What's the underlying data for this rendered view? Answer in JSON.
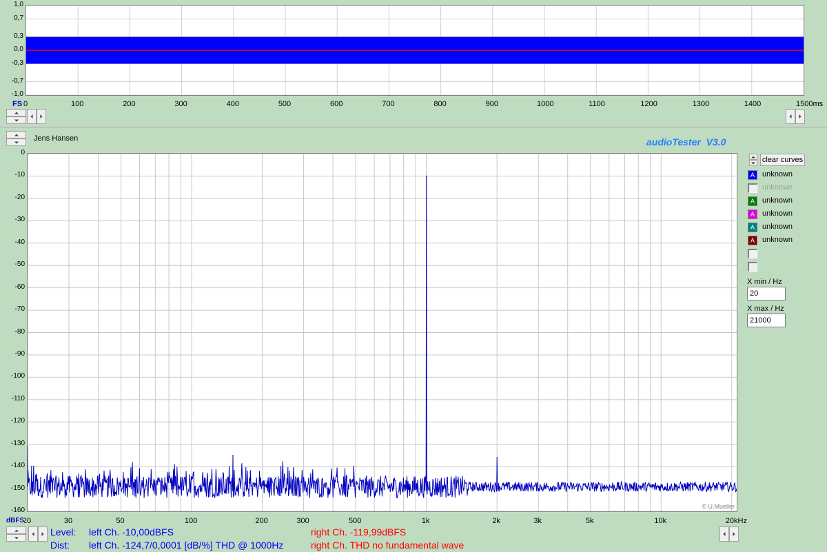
{
  "top_plot": {
    "y_ticks": [
      "1,0",
      "0,7",
      "0,3",
      "0,0",
      "-0,3",
      "-0,7",
      "-1,0"
    ],
    "x_ticks": [
      "0",
      "100",
      "200",
      "300",
      "400",
      "500",
      "600",
      "700",
      "800",
      "900",
      "1000",
      "1100",
      "1200",
      "1300",
      "1400",
      "1500ms"
    ],
    "y_unit": "FS",
    "fill_color": "#0000ff",
    "line_color": "#ff0000",
    "signal_level_range": [
      -0.3,
      0.3
    ]
  },
  "header": {
    "user_name": "Jens Hansen",
    "app_title": "audioTester  V3.0"
  },
  "spectrum": {
    "y_unit": "dBFS",
    "x_unit": "Hz",
    "credit": "© U.Mueller",
    "line_color": "#0000c0"
  },
  "chart_data": {
    "type": "line",
    "x_scale": "log",
    "xlim": [
      20,
      21000
    ],
    "ylim": [
      -160,
      0
    ],
    "y_ticks": [
      0,
      -10,
      -20,
      -30,
      -40,
      -50,
      -60,
      -70,
      -80,
      -90,
      -100,
      -110,
      -120,
      -130,
      -140,
      -150,
      -160
    ],
    "x_tick_labels": [
      "20",
      "30",
      "50",
      "100",
      "200",
      "300",
      "500",
      "1k",
      "2k",
      "3k",
      "5k",
      "10k",
      "20kHz"
    ],
    "x_tick_values": [
      20,
      30,
      50,
      100,
      200,
      300,
      500,
      1000,
      2000,
      3000,
      5000,
      10000,
      20000
    ],
    "grid": true,
    "series": [
      {
        "name": "unknown",
        "color": "#0000c0",
        "noise_floor": -149,
        "peaks": [
          {
            "x": 20,
            "y": -131
          },
          {
            "x": 150,
            "y": -135
          },
          {
            "x": 240,
            "y": -140
          },
          {
            "x": 450,
            "y": -141
          },
          {
            "x": 1000,
            "y": -10
          },
          {
            "x": 2000,
            "y": -136
          }
        ]
      }
    ]
  },
  "controls": {
    "clear_curves": "clear curves",
    "x_min_label": "X min / Hz",
    "x_min_value": "20",
    "x_max_label": "X max / Hz",
    "x_max_value": "21000"
  },
  "legend": [
    {
      "glyph": "A",
      "label": "unknown",
      "color": "#0000ff",
      "enabled": true
    },
    {
      "glyph": "",
      "label": "unknown",
      "color": "#ffffff",
      "enabled": false
    },
    {
      "glyph": "A",
      "label": "unknown",
      "color": "#008000",
      "enabled": true
    },
    {
      "glyph": "A",
      "label": "unknown",
      "color": "#e000e0",
      "enabled": true
    },
    {
      "glyph": "A",
      "label": "unknown",
      "color": "#008080",
      "enabled": true
    },
    {
      "glyph": "A",
      "label": "unknown",
      "color": "#800000",
      "enabled": true
    },
    {
      "glyph": "",
      "label": "",
      "color": "#ffffff",
      "enabled": false
    },
    {
      "glyph": "",
      "label": "",
      "color": "#ffffff",
      "enabled": false
    }
  ],
  "status": {
    "level_label": "Level:",
    "level_left": "left Ch. -10,00dBFS",
    "level_right": "right Ch. -119,99dBFS",
    "dist_label": "Dist:",
    "dist_left": "left Ch. -124,7/0,0001 [dB/%] THD @ 1000Hz",
    "dist_right": "right Ch. THD no fundamental wave",
    "left_color": "#0000ff",
    "right_color": "#ff0000"
  }
}
